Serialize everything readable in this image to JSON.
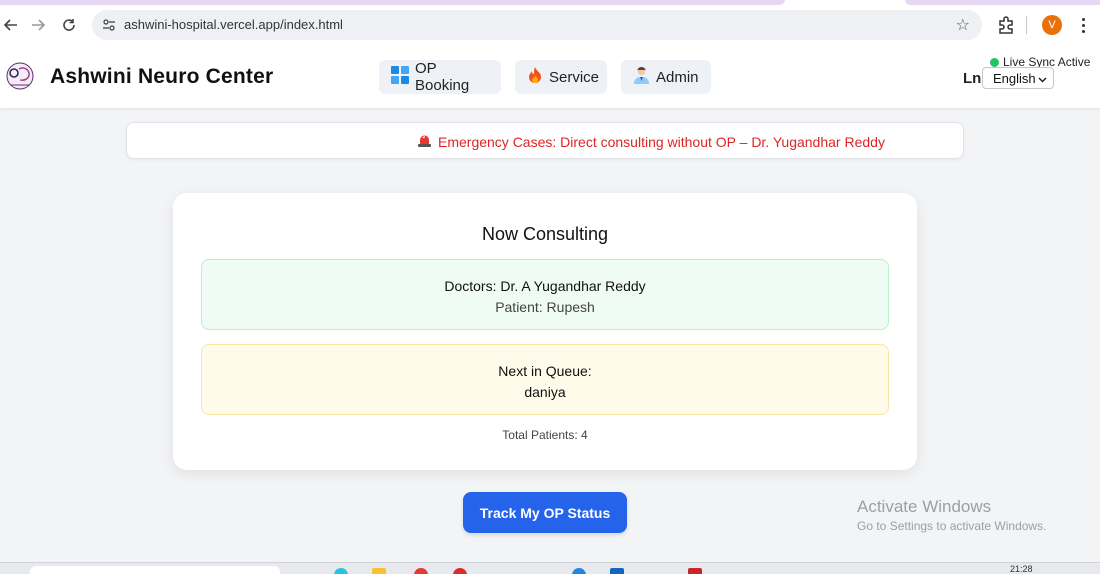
{
  "browser": {
    "url": "ashwini-hospital.vercel.app/index.html",
    "profile_initial": "V"
  },
  "header": {
    "brand": "Ashwini Neuro Center",
    "nav": [
      {
        "label": "OP Booking",
        "icon": "dashboard-grid-icon"
      },
      {
        "label": "Service",
        "icon": "fire-icon"
      },
      {
        "label": "Admin",
        "icon": "doctor-avatar-icon"
      }
    ],
    "language_label": "Ln",
    "language_selected": "English",
    "live_sync": "Live Sync Active"
  },
  "banner": {
    "icon": "siren-icon",
    "text": "Emergency Cases: Direct consulting without OP – Dr. Yugandhar Reddy"
  },
  "consulting": {
    "title": "Now Consulting",
    "doctor": "Doctors: Dr. A Yugandhar Reddy",
    "patient": "Patient: Rupesh",
    "next_label": "Next in Queue:",
    "next_name": "daniya",
    "total": "Total Patients: 4"
  },
  "track_button": "Track My OP Status",
  "watermark": {
    "title": "Activate Windows",
    "subtitle": "Go to Settings to activate Windows."
  },
  "taskbar": {
    "clock": "21:28"
  },
  "colors": {
    "accent": "#2563eb",
    "emergency": "#dc2626",
    "consulting_bg": "#effcf3",
    "queue_bg": "#fffbea",
    "live": "#22c55e"
  }
}
